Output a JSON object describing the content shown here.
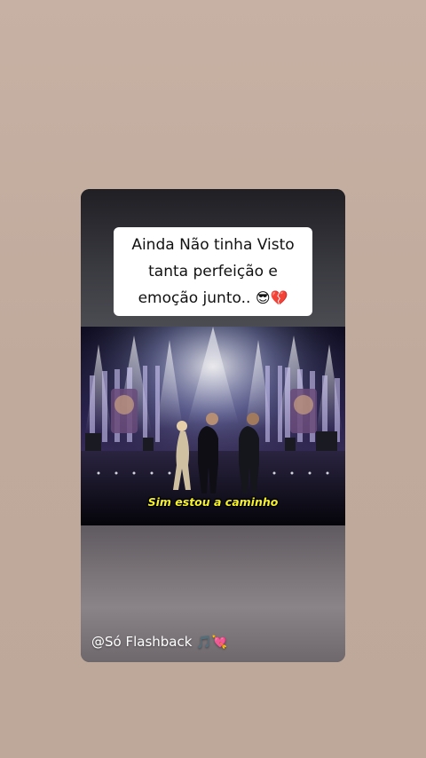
{
  "story": {
    "caption": {
      "line1": "Ainda Não tinha Visto",
      "line2": "tanta perfeição e",
      "line3": "emoção junto..",
      "line3_emoji": "😎💔"
    },
    "video": {
      "subtitle": "Sim estou a caminho"
    },
    "handle": {
      "text": "@Só Flashback",
      "emoji": "🎵💘"
    }
  },
  "colors": {
    "background": "#c3ad9f",
    "subtitle": "#f5f12b",
    "caption_box": "#ffffff"
  }
}
